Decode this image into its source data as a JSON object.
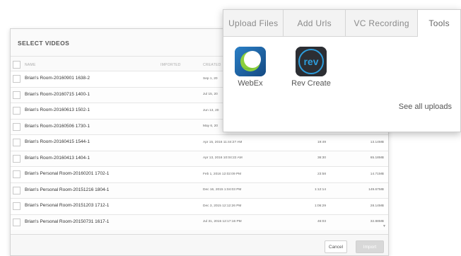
{
  "dialog": {
    "title": "SELECT VIDEOS",
    "columns": {
      "name": "NAME",
      "imported": "IMPORTED",
      "created": "CREATED"
    },
    "rows": [
      {
        "name": "Brian's Room-20160901 1638-2",
        "created": "Sep 1, 20",
        "duration": "",
        "size": ""
      },
      {
        "name": "Brian's Room-20160715 1400-1",
        "created": "Jul 15, 20",
        "duration": "",
        "size": ""
      },
      {
        "name": "Brian's Room-20160613 1502-1",
        "created": "Jun 13, 20",
        "duration": "",
        "size": ""
      },
      {
        "name": "Brian's Room-20160506 1730-1",
        "created": "May 6, 20",
        "duration": "",
        "size": ""
      },
      {
        "name": "Brian's Room-20160415 1544-1",
        "created": "Apr 15, 2016 11:44:27 AM",
        "duration": "19:49",
        "size": "13.14MB"
      },
      {
        "name": "Brian's Room-20160413 1404-1",
        "created": "Apr 13, 2016 10:04:22 AM",
        "duration": "36:30",
        "size": "65.18MB"
      },
      {
        "name": "Brian's Personal Room-20160201 1702-1",
        "created": "Feb 1, 2016 12:02:09 PM",
        "duration": "23:58",
        "size": "14.71MB"
      },
      {
        "name": "Brian's Personal Room-20151216 1804-1",
        "created": "Dec 16, 2015 1:04:03 PM",
        "duration": "1:12:14",
        "size": "149.67MB"
      },
      {
        "name": "Brian's Personal Room-20151203 1712-1",
        "created": "Dec 3, 2015 12:12:26 PM",
        "duration": "1:06:29",
        "size": "28.14MB"
      },
      {
        "name": "Brian's Personal Room-20150731 1617-1",
        "created": "Jul 31, 2015 12:17:16 PM",
        "duration": "46:03",
        "size": "32.88MB"
      }
    ],
    "cancel_label": "Cancel",
    "import_label": "Import"
  },
  "popup": {
    "tabs": [
      {
        "label": "Upload Files"
      },
      {
        "label": "Add Urls"
      },
      {
        "label": "VC Recording"
      },
      {
        "label": "Tools"
      }
    ],
    "active_tab": "Tools",
    "apps": [
      {
        "label": "WebEx",
        "icon": "webex-logo-icon"
      },
      {
        "label": "Rev Create",
        "icon": "rev-logo-icon",
        "icon_text": "rev"
      }
    ],
    "see_all_label": "See all uploads"
  },
  "colors": {
    "webex_blue": "#1f66a8",
    "webex_green": "#8ccf3c",
    "rev_dark": "#2c2e33",
    "rev_blue": "#2d9cdb"
  }
}
